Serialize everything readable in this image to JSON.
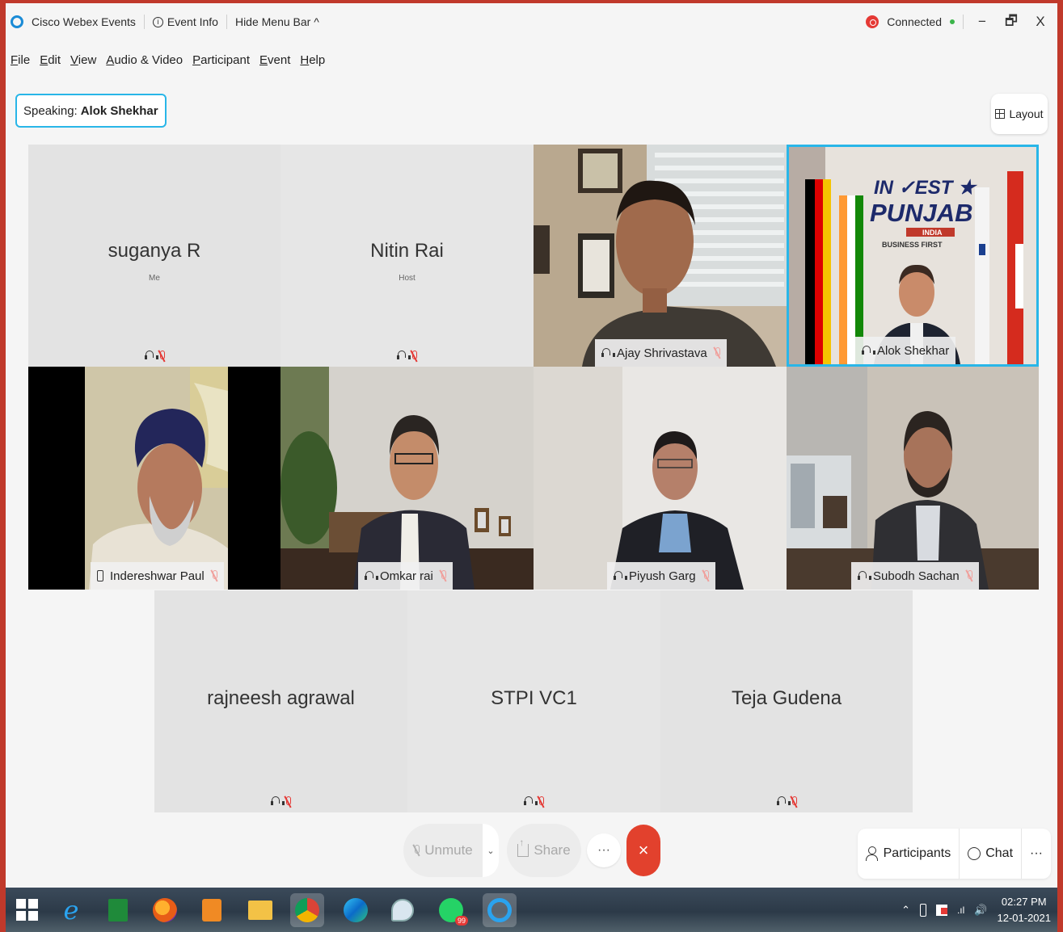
{
  "title_bar": {
    "app_name": "Cisco Webex Events",
    "event_info": "Event Info",
    "hide_menu": "Hide Menu Bar ^",
    "status": "Connected",
    "minimize": "−",
    "restore": "🗗",
    "close": "X"
  },
  "menu": [
    "File",
    "Edit",
    "View",
    "Audio & Video",
    "Participant",
    "Event",
    "Help"
  ],
  "speaking": {
    "label": "Speaking:",
    "name": "Alok Shekhar"
  },
  "layout_label": "Layout",
  "participants": [
    {
      "name": "suganya R",
      "role": "Me"
    },
    {
      "name": "Nitin Rai",
      "role": "Host"
    },
    {
      "name": "Ajay Shrivastava"
    },
    {
      "name": "Alok Shekhar"
    },
    {
      "name": "Indereshwar Paul"
    },
    {
      "name": "Omkar rai"
    },
    {
      "name": "Piyush Garg"
    },
    {
      "name": "Subodh Sachan"
    },
    {
      "name": "rajneesh agrawal"
    },
    {
      "name": "STPI VC1"
    },
    {
      "name": "Teja Gudena"
    }
  ],
  "banner": {
    "line1": "IN ✓EST ★",
    "line2": "PUNJAB",
    "line3": "INDIA",
    "line4": "BUSINESS FIRST"
  },
  "controls": {
    "unmute": "Unmute",
    "share": "Share",
    "more": "···",
    "end": "×",
    "participants": "Participants",
    "chat": "Chat",
    "right_more": "···"
  },
  "taskbar": {
    "whatsapp_badge": "99",
    "time": "02:27 PM",
    "date": "12-01-2021"
  },
  "colors": {
    "accent": "#29b6e8",
    "end_call": "#e2412d",
    "mute_red": "#e53935",
    "connected_green": "#3bb54a"
  }
}
